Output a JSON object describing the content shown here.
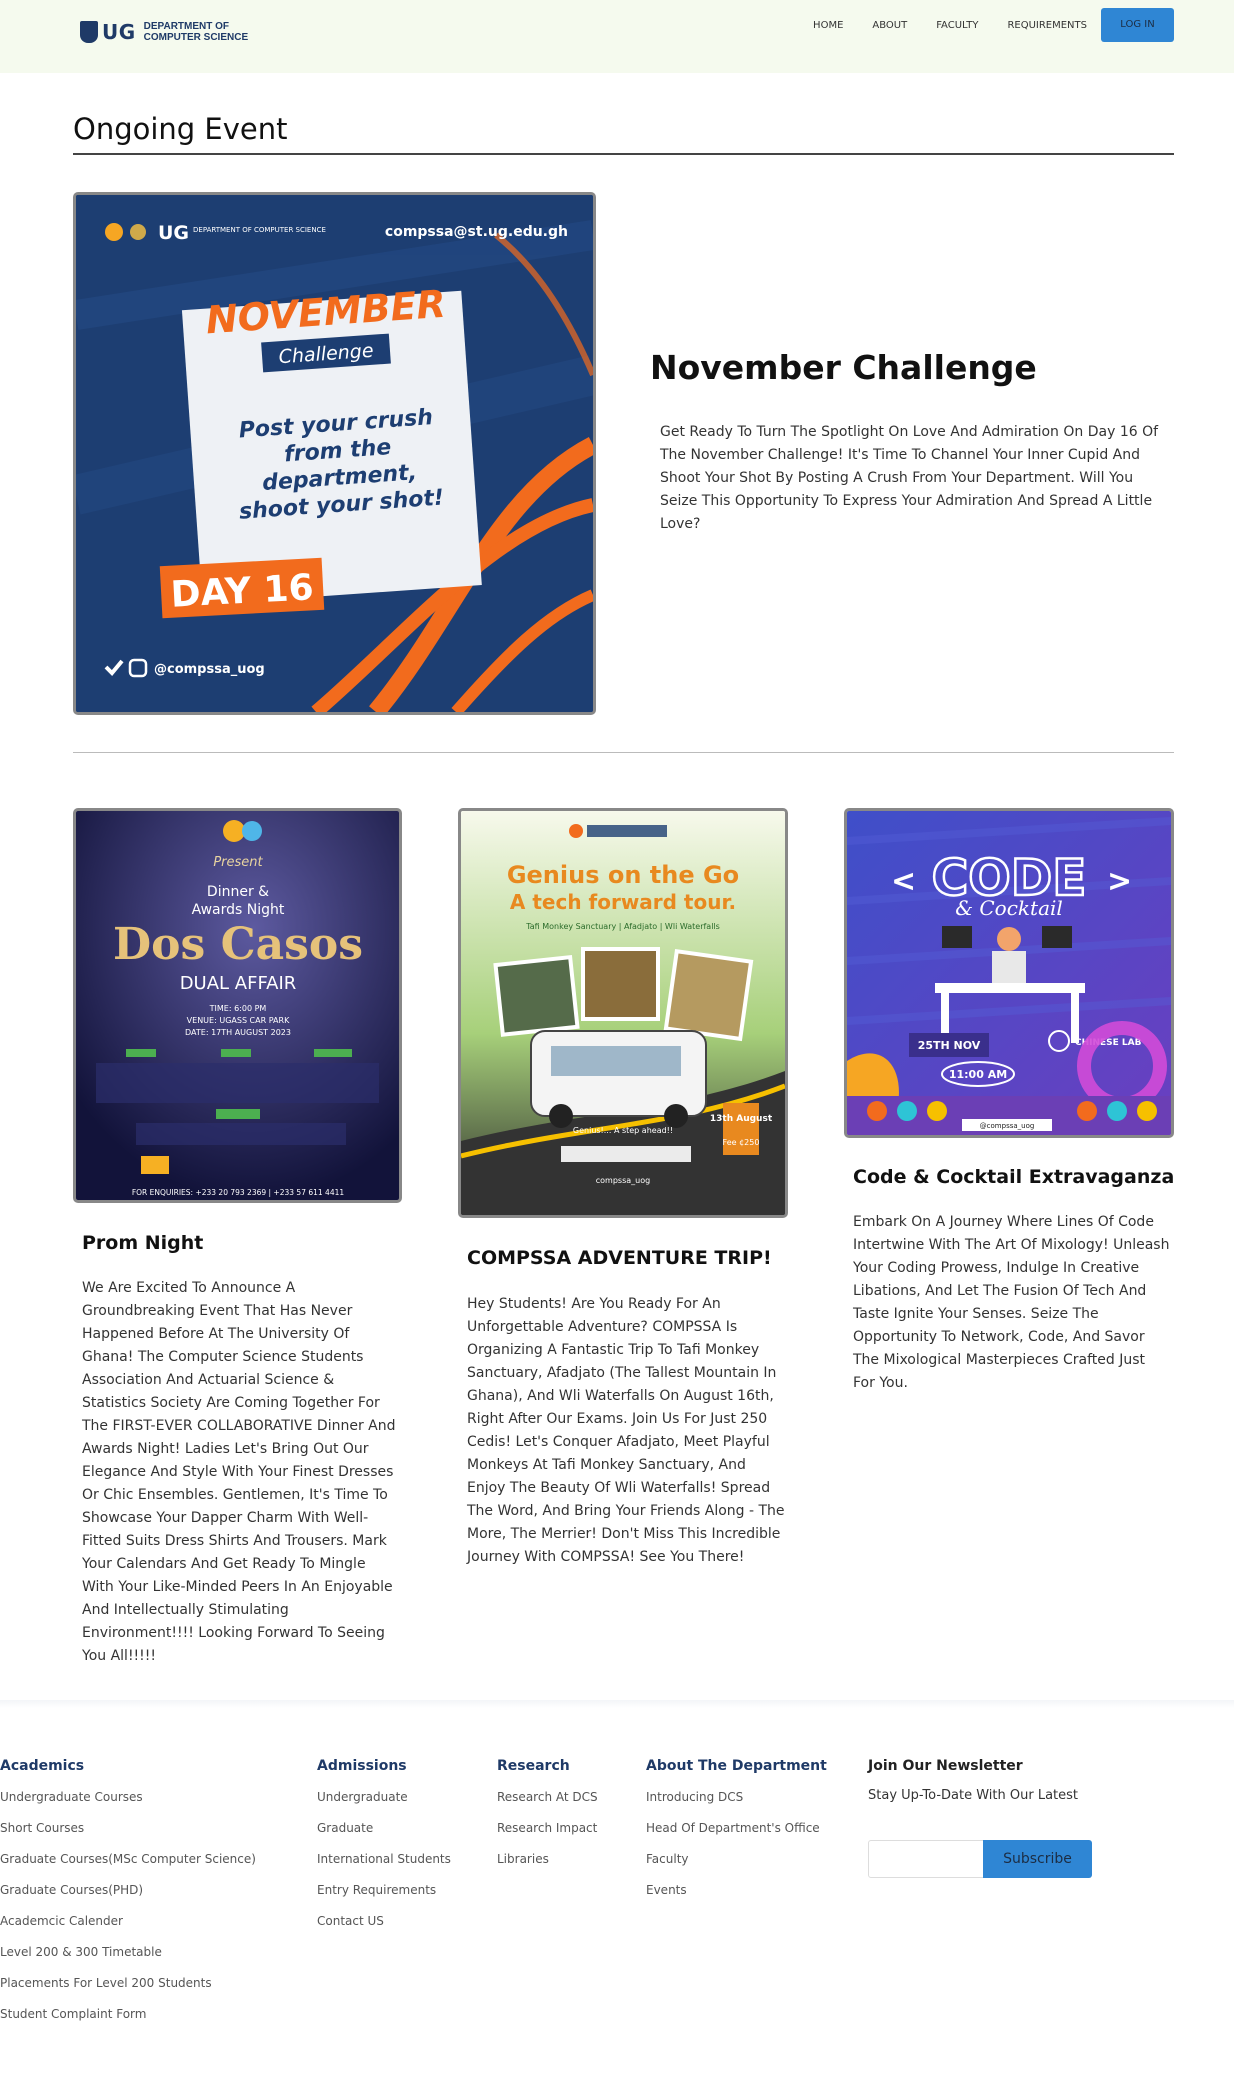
{
  "header": {
    "logo_ug": "UG",
    "logo_dept": "DEPARTMENT OF COMPUTER SCIENCE",
    "nav": [
      "HOME",
      "ABOUT",
      "FACULTY",
      "REQUIREMENTS"
    ],
    "login": "LOG IN"
  },
  "ongoing": {
    "heading": "Ongoing Event",
    "title": "November Challenge",
    "description": "Get Ready To Turn The Spotlight On Love And Admiration On Day 16 Of The November Challenge! It's Time To Channel Your Inner Cupid And Shoot Your Shot By Posting A Crush From Your Department. Will You Seize This Opportunity To Express Your Admiration And Spread A Little Love?",
    "poster": {
      "logo_ug": "UG",
      "logo_dept": "DEPARTMENT OF COMPUTER SCIENCE",
      "email": "compssa@st.ug.edu.gh",
      "month": "NOVEMBER",
      "challenge": "Challenge",
      "message": "Post your crush from the department, shoot your shot!",
      "day": "DAY 16",
      "handle": "@compssa_uog"
    }
  },
  "events": [
    {
      "title": "Prom Night",
      "description": "We Are Excited To Announce A Groundbreaking Event That Has Never Happened Before At The University Of Ghana! The Computer Science Students Association And Actuarial Science & Statistics Society Are Coming Together For The FIRST-EVER COLLABORATIVE Dinner And Awards Night! Ladies Let's Bring Out Our Elegance And Style With Your Finest Dresses Or Chic Ensembles. Gentlemen, It's Time To Showcase Your Dapper Charm With Well-Fitted Suits Dress Shirts And Trousers. Mark Your Calendars And Get Ready To Mingle With Your Like-Minded Peers In An Enjoyable And Intellectually Stimulating Environment!!!! Looking Forward To Seeing You All!!!!!",
      "poster": {
        "present": "Present",
        "line1": "Dinner &",
        "line2": "Awards Night",
        "big": "Dos Casos",
        "sub": "DUAL AFFAIR",
        "time": "TIME: 6:00 PM",
        "venue": "VENUE: UGASS CAR PARK",
        "date": "DATE: 17TH AUGUST 2023",
        "enquiries": "FOR ENQUIRIES: +233 20 793 2369 | +233 57 611 4411"
      }
    },
    {
      "title": "COMPSSA ADVENTURE TRIP!",
      "description": "Hey Students! Are You Ready For An Unforgettable Adventure? COMPSSA Is Organizing A Fantastic Trip To Tafi Monkey Sanctuary, Afadjato (The Tallest Mountain In Ghana), And Wli Waterfalls On August 16th, Right After Our Exams. Join Us For Just 250 Cedis! Let's Conquer Afadjato, Meet Playful Monkeys At Tafi Monkey Sanctuary, And Enjoy The Beauty Of Wli Waterfalls! Spread The Word, And Bring Your Friends Along - The More, The Merrier! Don't Miss This Incredible Journey With COMPSSA! See You There!",
      "poster": {
        "heading": "Genius on the Go",
        "sub": "A tech forward tour.",
        "places": "Tafi Monkey Sanctuary | Afadjato | Wli Waterfalls",
        "tag": "Genius!... A step ahead!!",
        "date_badge": "13th August",
        "fee": "Fee ¢250",
        "handle": "compssa_uog"
      }
    },
    {
      "title": "Code & Cocktail Extravaganza",
      "description": "Embark On A Journey Where Lines Of Code Intertwine With The Art Of Mixology! Unleash Your Coding Prowess, Indulge In Creative Libations, And Let The Fusion Of Tech And Taste Ignite Your Senses. Seize The Opportunity To Network, Code, And Savor The Mixological Masterpieces Crafted Just For You.",
      "poster": {
        "code": "CODE",
        "cocktail": "& Cocktail",
        "date": "25TH NOV",
        "venue": "CHINESE LAB",
        "time": "11:00 AM",
        "handle": "@compssa_uog"
      }
    }
  ],
  "footer": {
    "academics": {
      "title": "Academics",
      "links": [
        "Undergraduate Courses",
        "Short Courses",
        "Graduate Courses(MSc Computer Science)",
        "Graduate Courses(PHD)",
        "Academcic Calender",
        "Level 200 & 300 Timetable",
        "Placements For Level 200 Students",
        "Student Complaint Form"
      ]
    },
    "admissions": {
      "title": "Admissions",
      "links": [
        "Undergraduate",
        "Graduate",
        "International Students",
        "Entry Requirements",
        "Contact US"
      ]
    },
    "research": {
      "title": "Research",
      "links": [
        "Research At DCS",
        "Research Impact",
        "Libraries"
      ]
    },
    "about": {
      "title": "About The Department",
      "links": [
        "Introducing DCS",
        "Head Of Department's Office",
        "Faculty",
        "Events"
      ]
    },
    "newsletter": {
      "title": "Join Our Newsletter",
      "text": "Stay Up-To-Date With Our Latest",
      "input_value": "",
      "button": "Subscribe"
    }
  },
  "colors": {
    "accent": "#2f86d4",
    "navy": "#1f3a67",
    "orange": "#f26b1d"
  }
}
